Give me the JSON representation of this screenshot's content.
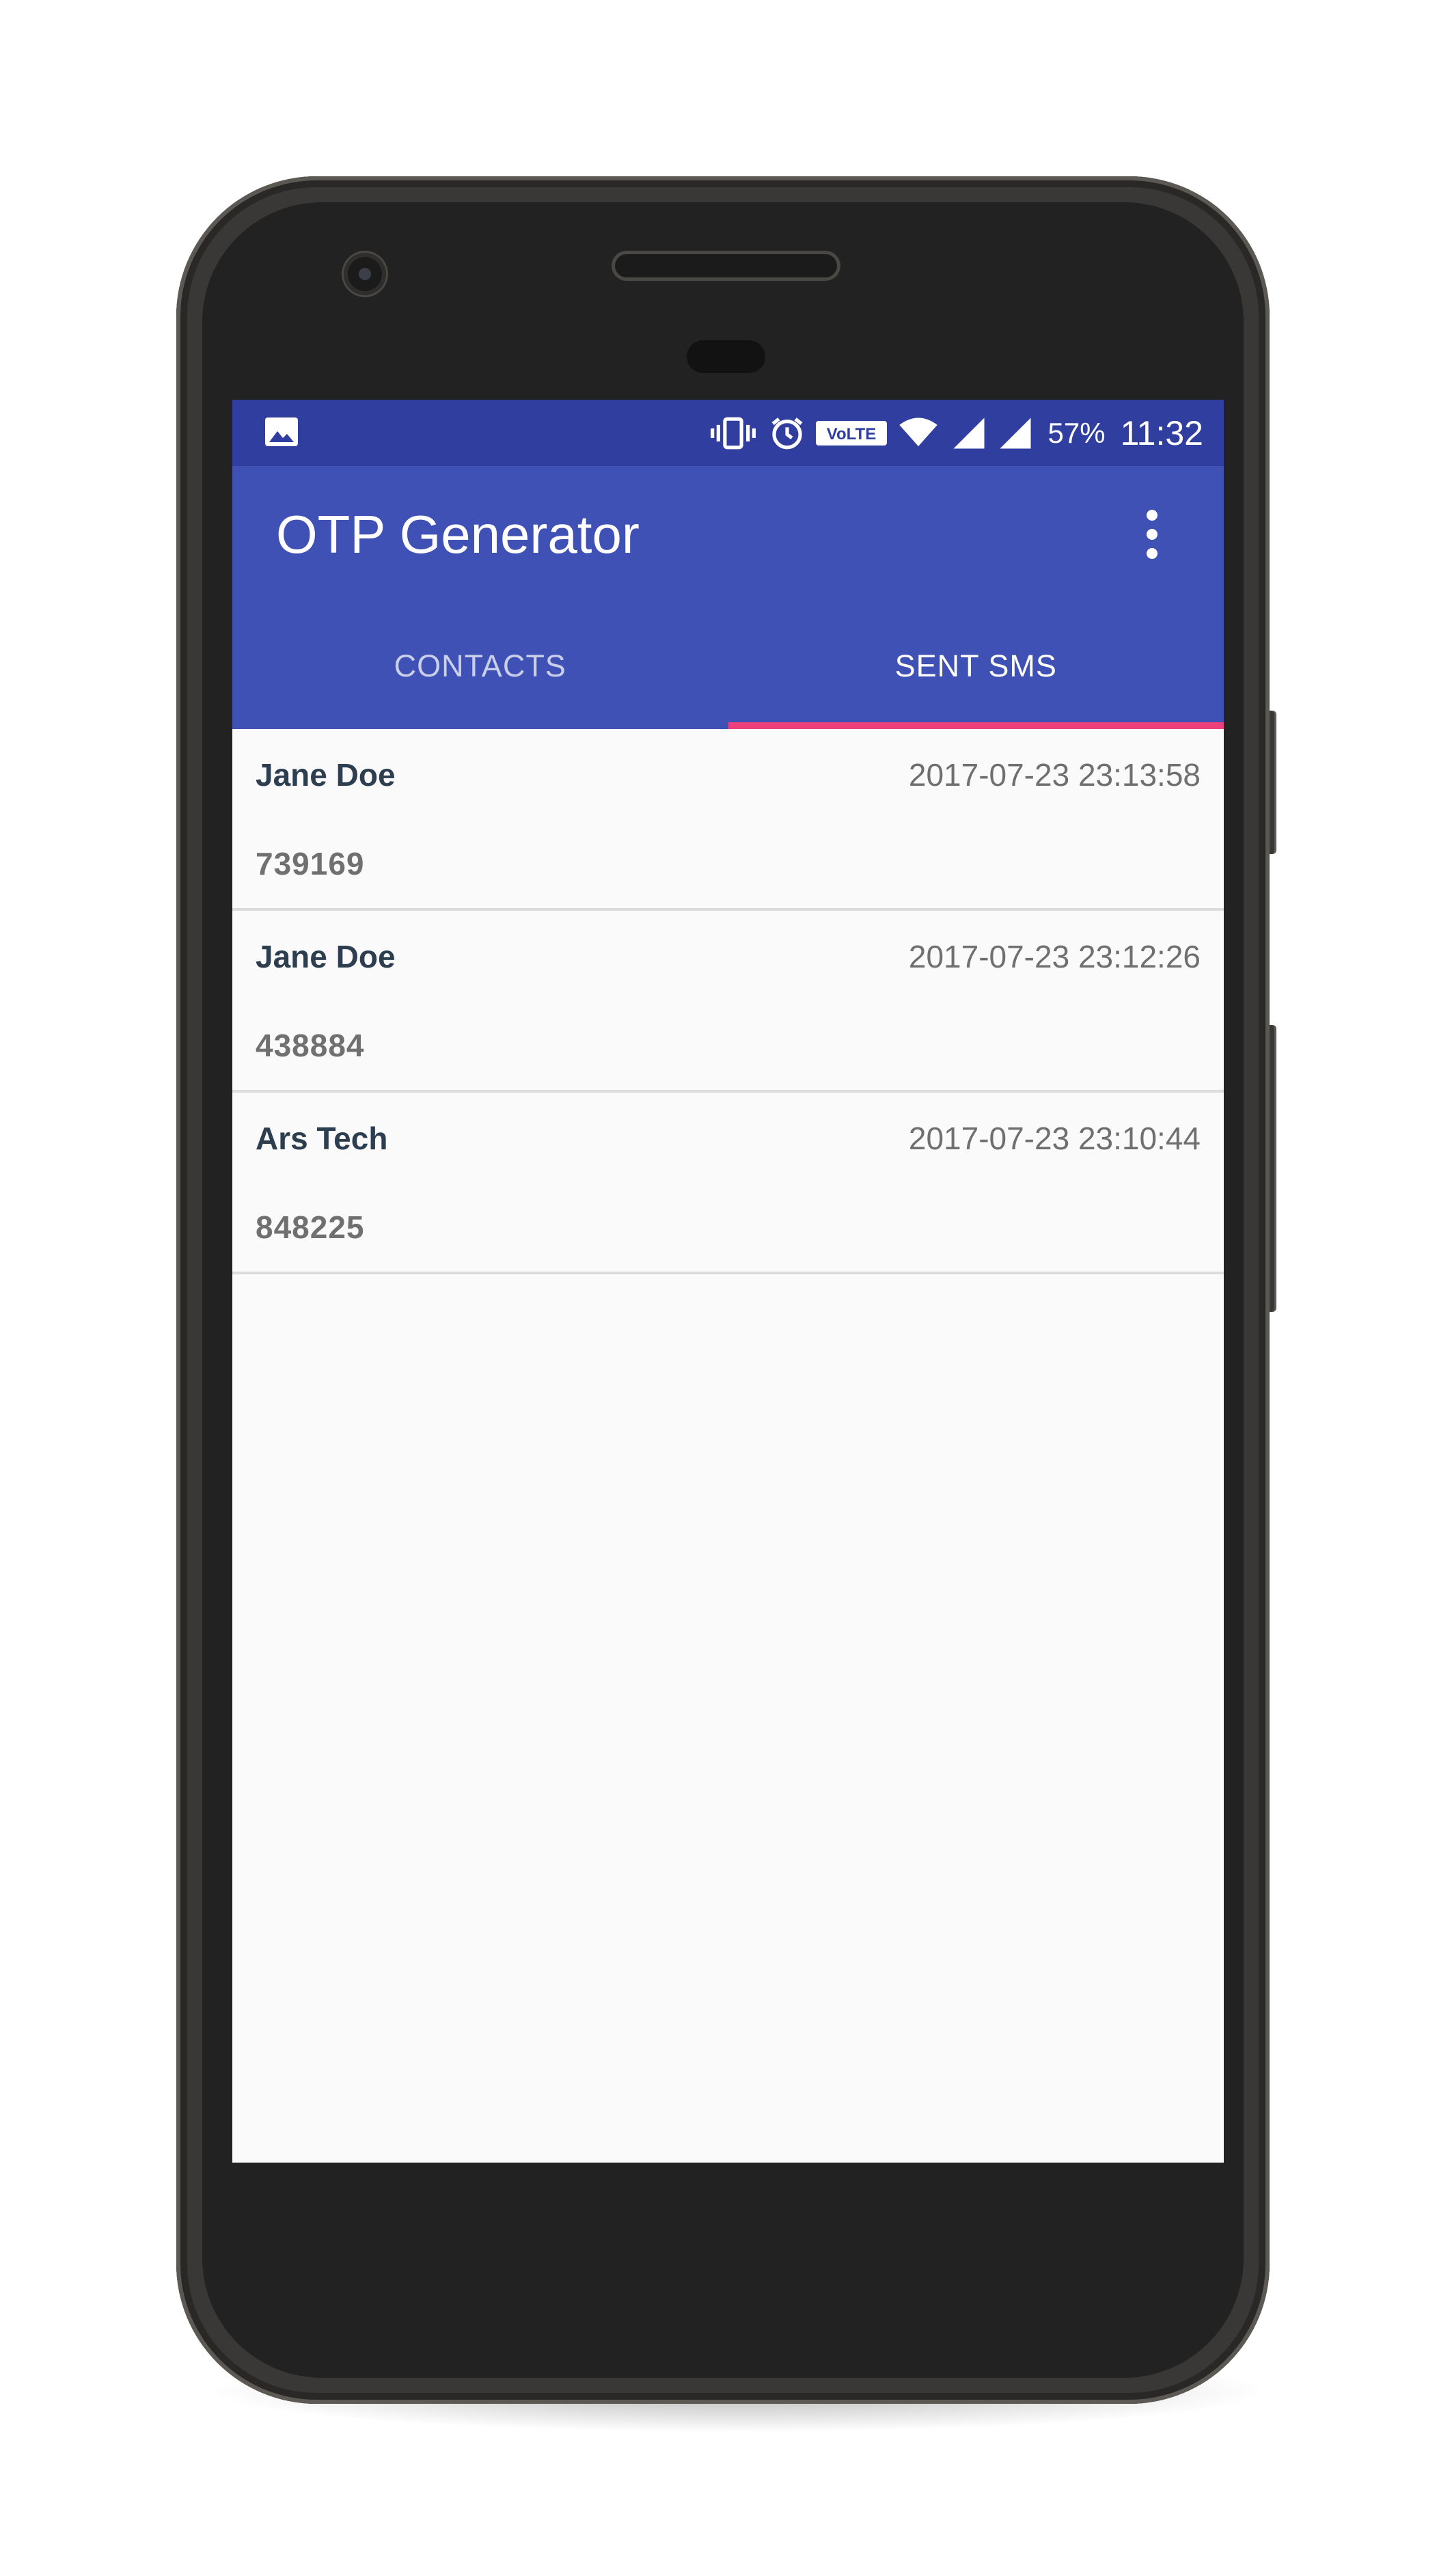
{
  "status_bar": {
    "battery": "57%",
    "time": "11:32",
    "volte_label": "VoLTE",
    "icons": [
      "image-icon",
      "vibrate-icon",
      "alarm-icon",
      "volte-icon",
      "wifi-icon",
      "signal-icon",
      "signal-icon"
    ]
  },
  "app_bar": {
    "title": "OTP Generator",
    "menu_icon": "more-vert-icon"
  },
  "tabs": [
    {
      "label": "CONTACTS",
      "active": false
    },
    {
      "label": "SENT SMS",
      "active": true
    }
  ],
  "messages": [
    {
      "name": "Jane Doe",
      "timestamp": "2017-07-23 23:13:58",
      "otp": "739169"
    },
    {
      "name": "Jane Doe",
      "timestamp": "2017-07-23 23:12:26",
      "otp": "438884"
    },
    {
      "name": "Ars Tech",
      "timestamp": "2017-07-23 23:10:44",
      "otp": "848225"
    }
  ],
  "colors": {
    "status_bar": "#303f9f",
    "primary": "#3f51b5",
    "accent": "#ec407a",
    "background": "#fafafa"
  }
}
